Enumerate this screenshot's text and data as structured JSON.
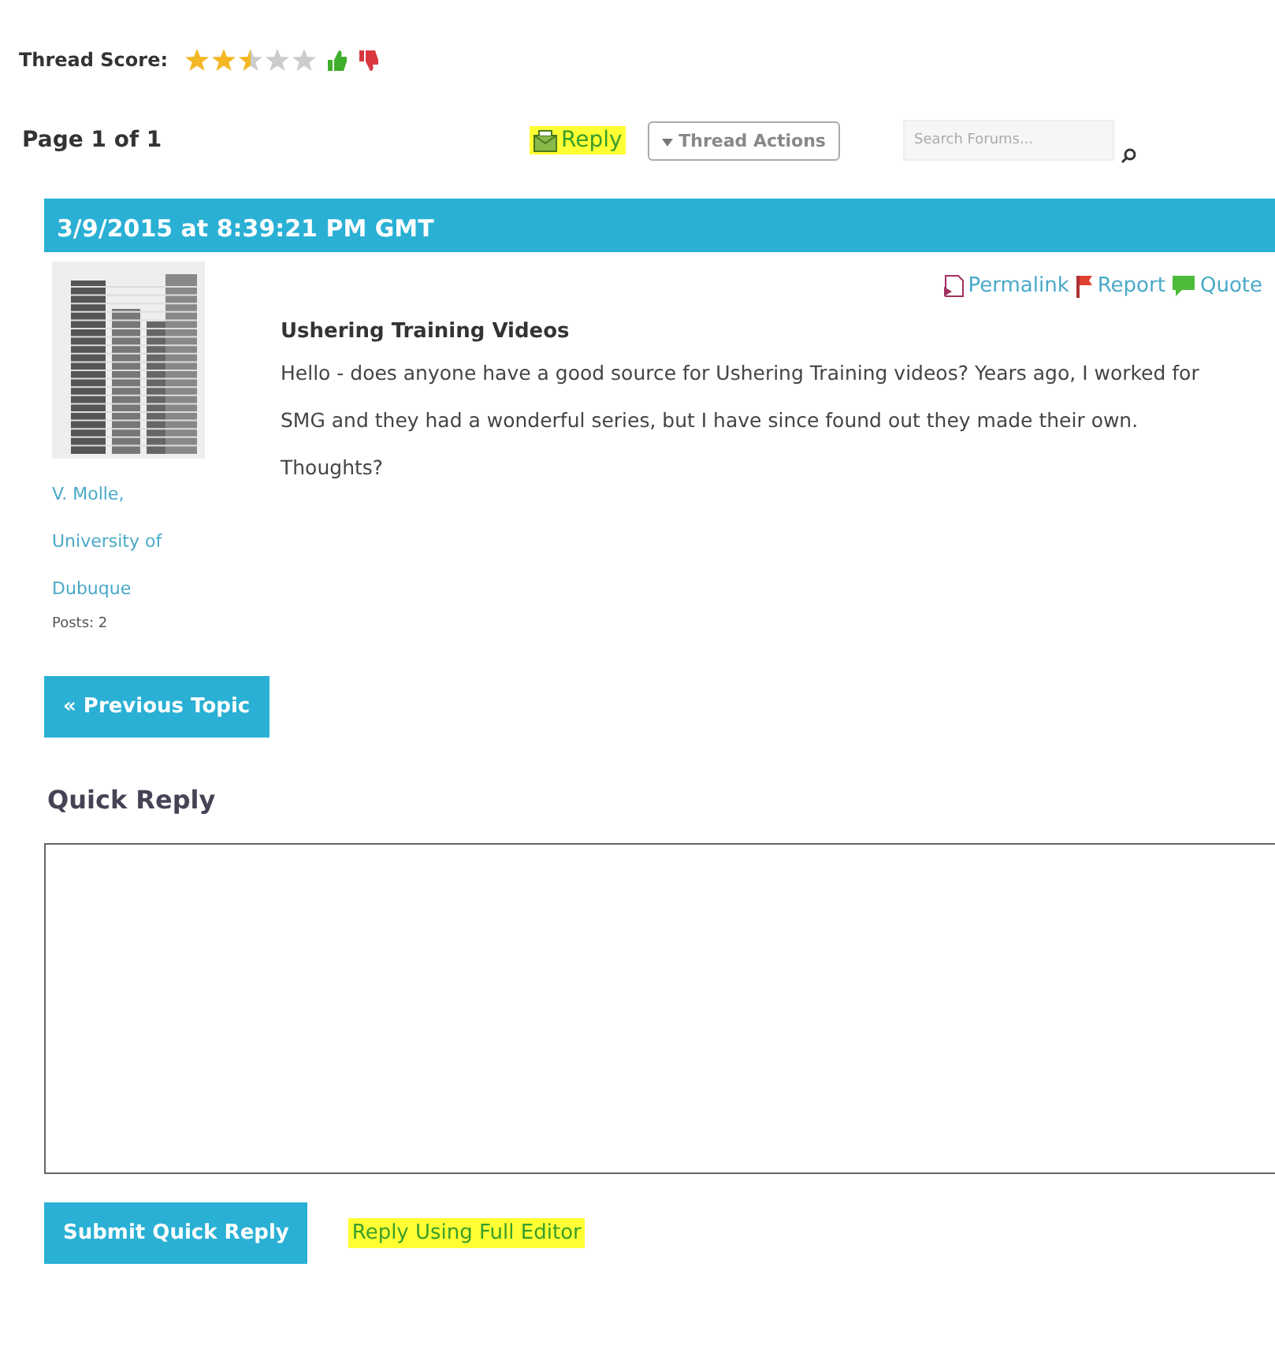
{
  "thread_score": {
    "label": "Thread Score:",
    "stars": 2.5
  },
  "toolbar": {
    "page": "Page 1 of 1",
    "reply": {
      "label": "Reply",
      "highlighted": true
    },
    "thread_actions": "Thread Actions",
    "search": {
      "placeholder": "Search Forums..."
    }
  },
  "post": {
    "date": "3/9/2015 at 8:39:21 PM GMT",
    "author": [
      "V. Molle,",
      "University of",
      "Dubuque"
    ],
    "posts": "Posts: 2",
    "actions": [
      "Permalink",
      "Report",
      "Quote"
    ],
    "title": "Ushering Training Videos",
    "body": "Hello - does anyone have a good source for Ushering Training videos? Years ago, I worked for SMG and they had a wonderful series, but I have since found out they made their own. Thoughts?"
  },
  "previous_topic": "« Previous Topic",
  "quick_reply": {
    "heading": "Quick Reply",
    "submit": "Submit Quick Reply",
    "full_editor": {
      "label": "Reply Using Full Editor",
      "highlighted": true
    }
  }
}
